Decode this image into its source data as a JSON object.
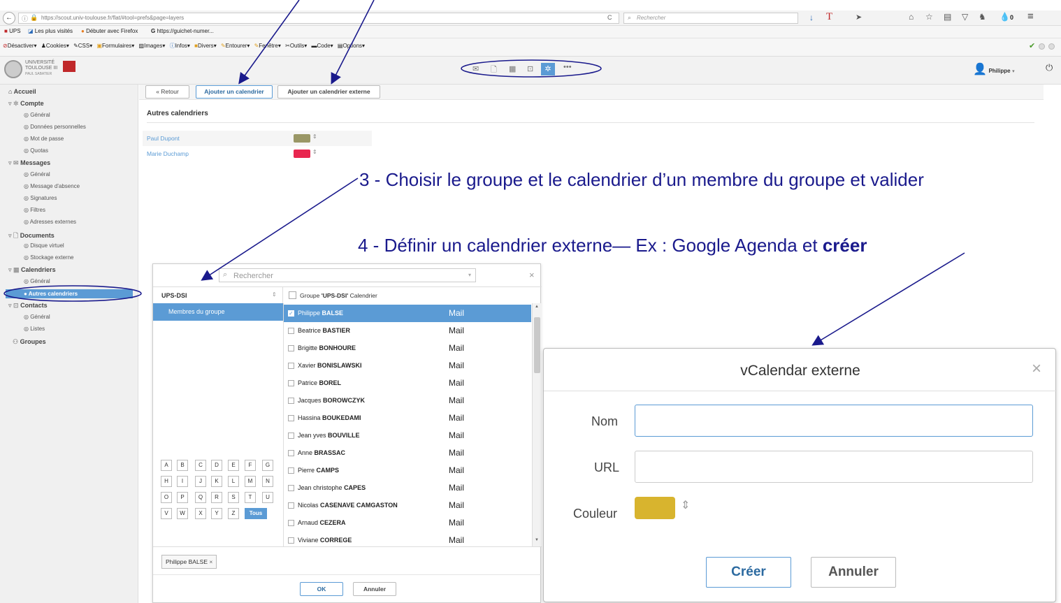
{
  "browser": {
    "url": "https://scout.univ-toulouse.fr/flat/#tool=prefs&page=layers",
    "search_placeholder": "Rechercher",
    "bookmarks": [
      "UPS",
      "Les plus visités",
      "Débuter avec Firefox",
      "https://guichet-numer..."
    ],
    "toolbar": [
      "Désactiver",
      "Cookies",
      "CSS",
      "Formulaires",
      "Images",
      "Infos",
      "Divers",
      "Entourer",
      "Fenêtre",
      "Outils",
      "Code",
      "Options"
    ],
    "badge": "0"
  },
  "header": {
    "logo_line1": "UNIVERSITÉ",
    "logo_line2": "TOULOUSE III",
    "logo_line3": "PAUL SABATIER",
    "user": "Philippe"
  },
  "sidebar": {
    "home": "Accueil",
    "compte": "Compte",
    "compte_items": [
      "Général",
      "Données personnelles",
      "Mot de passe",
      "Quotas"
    ],
    "messages": "Messages",
    "messages_items": [
      "Général",
      "Message d'absence",
      "Signatures",
      "Filtres",
      "Adresses externes"
    ],
    "documents": "Documents",
    "documents_items": [
      "Disque virtuel",
      "Stockage externe"
    ],
    "calendriers": "Calendriers",
    "calendriers_items": [
      "Général",
      "Autres calendriers"
    ],
    "contacts": "Contacts",
    "contacts_items": [
      "Général",
      "Listes"
    ],
    "groupes": "Groupes"
  },
  "actions": {
    "back": "« Retour",
    "add_calendar": "Ajouter un calendrier",
    "add_external": "Ajouter un calendrier externe"
  },
  "main": {
    "section_title": "Autres calendriers",
    "calendars": [
      {
        "name": "Paul Dupont",
        "color": "#9a9766"
      },
      {
        "name": "Marie Duchamp",
        "color": "#e8264f"
      }
    ]
  },
  "annotations": {
    "step3": "3 - Choisir le groupe et le calendrier d’un membre du groupe et valider",
    "step4_prefix": "4 - Définir un calendrier externe— Ex : Google Agenda et ",
    "step4_bold": "créer"
  },
  "picker": {
    "search_placeholder": "Rechercher",
    "group": "UPS-DSI",
    "group_header_prefix": "Groupe ",
    "group_header_bold": "'UPS-DSI'",
    "group_header_suffix": " Calendrier",
    "group_members_label": "Membres du groupe",
    "letters": [
      "A",
      "B",
      "C",
      "D",
      "E",
      "F",
      "G",
      "H",
      "I",
      "J",
      "K",
      "L",
      "M",
      "N",
      "O",
      "P",
      "Q",
      "R",
      "S",
      "T",
      "U",
      "V",
      "W",
      "X",
      "Y",
      "Z"
    ],
    "all_label": "Tous",
    "mail_label": "Mail",
    "members": [
      {
        "first": "Philippe",
        "last": "BALSE"
      },
      {
        "first": "Beatrice",
        "last": "BASTIER"
      },
      {
        "first": "Brigitte",
        "last": "BONHOURE"
      },
      {
        "first": "Xavier",
        "last": "BONISLAWSKI"
      },
      {
        "first": "Patrice",
        "last": "BOREL"
      },
      {
        "first": "Jacques",
        "last": "BOROWCZYK"
      },
      {
        "first": "Hassina",
        "last": "BOUKEDAMI"
      },
      {
        "first": "Jean yves",
        "last": "BOUVILLE"
      },
      {
        "first": "Anne",
        "last": "BRASSAC"
      },
      {
        "first": "Pierre",
        "last": "CAMPS"
      },
      {
        "first": "Jean christophe",
        "last": "CAPES"
      },
      {
        "first": "Nicolas",
        "last": "CASENAVE CAMGASTON"
      },
      {
        "first": "Arnaud",
        "last": "CEZERA"
      },
      {
        "first": "Viviane",
        "last": "CORREGE"
      }
    ],
    "selected_tag": "Philippe BALSE",
    "ok": "OK",
    "cancel": "Annuler"
  },
  "vcal": {
    "title": "vCalendar externe",
    "name_label": "Nom",
    "url_label": "URL",
    "color_label": "Couleur",
    "color": "#d8b42e",
    "create": "Créer",
    "cancel": "Annuler"
  }
}
